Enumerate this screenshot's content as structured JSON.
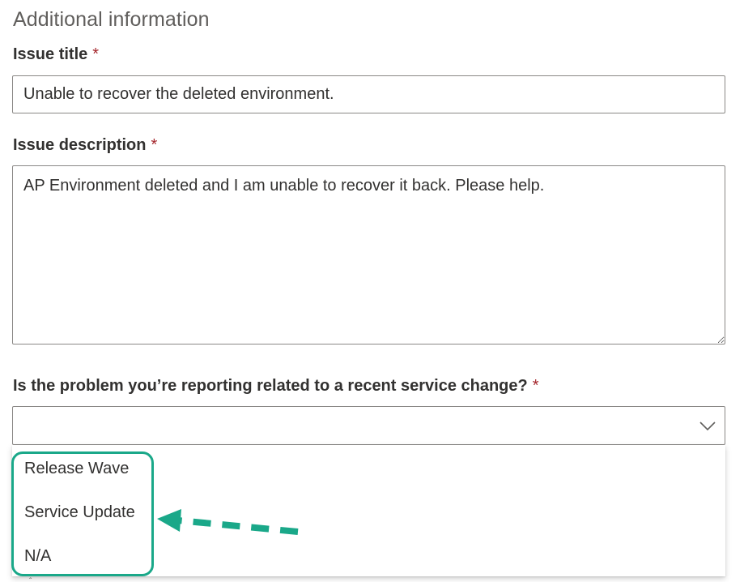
{
  "section": {
    "title": "Additional information"
  },
  "issue_title": {
    "label": "Issue title",
    "required_mark": "*",
    "value": "Unable to recover the deleted environment."
  },
  "issue_description": {
    "label": "Issue description",
    "required_mark": "*",
    "value": "AP Environment deleted and I am unable to recover it back. Please help."
  },
  "service_change": {
    "label": "Is the problem you’re reporting related to a recent service change?",
    "required_mark": "*",
    "selected": "",
    "options": [
      "Release Wave",
      "Service Update",
      "N/A"
    ]
  },
  "colors": {
    "highlight": "#1aa889",
    "required": "#a4262c",
    "border": "#8a8886"
  },
  "icons": {
    "dropdown": "chevron-down-icon",
    "annotation": "dashed-arrow-icon"
  }
}
